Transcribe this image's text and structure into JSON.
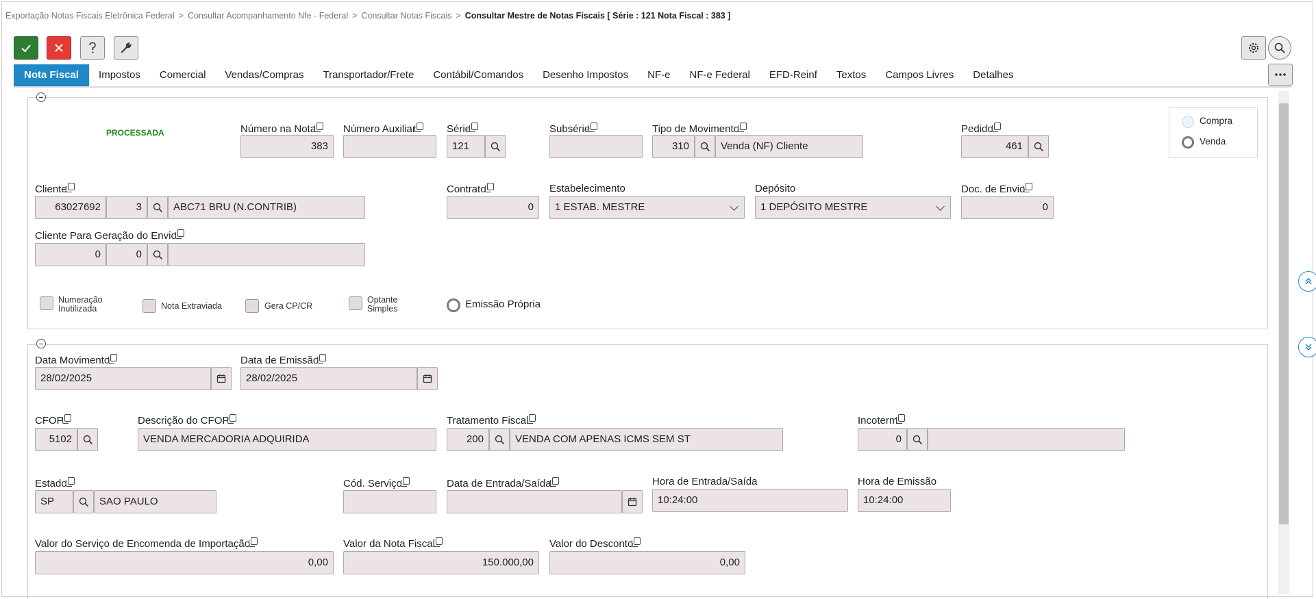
{
  "breadcrumb": {
    "items": [
      "Exportação Notas Fiscais Eletrônica Federal",
      "Consultar Acompanhamento Nfe - Federal",
      "Consultar Notas Fiscais"
    ],
    "current": "Consultar Mestre de Notas Fiscais [ Série : 121 Nota Fiscal : 383 ]",
    "separator": ">"
  },
  "tabs": [
    "Nota Fiscal",
    "Impostos",
    "Comercial",
    "Vendas/Compras",
    "Transportador/Frete",
    "Contábil/Comandos",
    "Desenho Impostos",
    "NF-e",
    "NF-e Federal",
    "EFD-Reinf",
    "Textos",
    "Campos Livres",
    "Detalhes"
  ],
  "colors": {
    "accent": "#1e88c8",
    "ok": "#2e7d32",
    "cancel": "#e53935",
    "status": "#1f8a1f"
  },
  "section1": {
    "status": "PROCESSADA",
    "numero_nota": {
      "label": "Número na Nota",
      "value": "383"
    },
    "numero_auxiliar": {
      "label": "Número Auxiliar",
      "value": ""
    },
    "serie": {
      "label": "Série",
      "value": "121"
    },
    "subserie": {
      "label": "Subsérie",
      "value": ""
    },
    "tipo_movimento": {
      "label": "Tipo de Movimento",
      "code": "310",
      "desc": "Venda (NF) Cliente"
    },
    "pedido": {
      "label": "Pedido",
      "value": "461"
    },
    "radio": {
      "compra": "Compra",
      "venda": "Venda"
    },
    "cliente": {
      "label": "Cliente",
      "code": "63027692",
      "seq": "3",
      "name": "ABC71 BRU (N.CONTRIB)"
    },
    "contrato": {
      "label": "Contrato",
      "value": "0"
    },
    "estabelecimento": {
      "label": "Estabelecimento",
      "value": "1 ESTAB. MESTRE"
    },
    "deposito": {
      "label": "Depósito",
      "value": "1 DEPÓSITO MESTRE"
    },
    "doc_envio": {
      "label": "Doc. de Envio",
      "value": "0"
    },
    "cliente_envio": {
      "label": "Cliente Para Geração do Envio",
      "code": "0",
      "seq": "0",
      "name": ""
    },
    "checks": {
      "numeracao_1": "Numeração",
      "numeracao_2": "Inutilizada",
      "extraviada": "Nota Extraviada",
      "gera_cp": "Gera CP/CR",
      "optante_1": "Optante",
      "optante_2": "Simples",
      "emissao": "Emissão Própria"
    }
  },
  "section2": {
    "data_movimento": {
      "label": "Data Movimento",
      "value": "28/02/2025"
    },
    "data_emissao": {
      "label": "Data de Emissão",
      "value": "28/02/2025"
    },
    "cfop": {
      "label": "CFOP",
      "value": "5102"
    },
    "desc_cfop": {
      "label": "Descrição do CFOP",
      "value": "VENDA MERCADORIA ADQUIRIDA"
    },
    "tratamento": {
      "label": "Tratamento Fiscal",
      "code": "200",
      "desc": "VENDA COM APENAS ICMS SEM ST"
    },
    "incoterm": {
      "label": "Incoterm",
      "code": "0",
      "desc": ""
    },
    "estado": {
      "label": "Estado",
      "code": "SP",
      "desc": "SAO PAULO"
    },
    "cod_servico": {
      "label": "Cód. Serviço",
      "value": ""
    },
    "data_entrada": {
      "label": "Data de Entrada/Saída",
      "value": ""
    },
    "hora_entrada": {
      "label": "Hora de Entrada/Saída",
      "value": "10:24:00"
    },
    "hora_emissao": {
      "label": "Hora de Emissão",
      "value": "10:24:00"
    },
    "valor_servico": {
      "label": "Valor do Serviço de Encomenda de Importação",
      "value": "0,00"
    },
    "valor_nota": {
      "label": "Valor da Nota Fiscal",
      "value": "150.000,00"
    },
    "valor_desconto": {
      "label": "Valor do Desconto",
      "value": "0,00"
    }
  }
}
